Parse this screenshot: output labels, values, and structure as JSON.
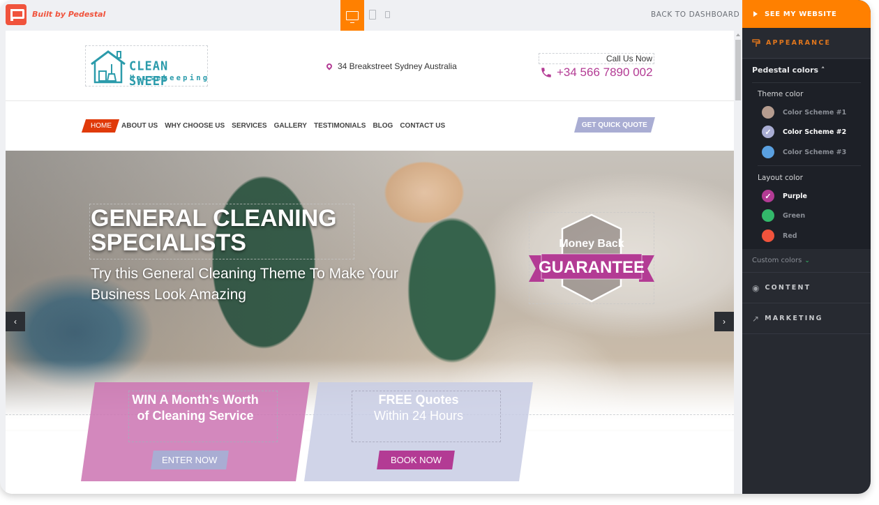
{
  "topbar": {
    "brand_text": "Built by Pedestal",
    "devices": [
      {
        "name": "desktop",
        "active": true
      },
      {
        "name": "tablet",
        "active": false
      },
      {
        "name": "mobile",
        "active": false
      }
    ],
    "back_label": "BACK TO DASHBOARD",
    "accent_color": "#ff8000"
  },
  "site": {
    "logo": {
      "line1": "CLEAN SWEEP",
      "line2": "Housekeeping"
    },
    "address": "34 Breakstreet Sydney Australia",
    "call_label": "Call Us Now",
    "phone": "+34 566 7890 002",
    "nav": {
      "items": [
        "HOME",
        "ABOUT US",
        "WHY CHOOSE US",
        "SERVICES",
        "GALLERY",
        "TESTIMONIALS",
        "BLOG",
        "CONTACT US"
      ],
      "active": "HOME",
      "quote_button": "GET QUICK QUOTE"
    },
    "hero": {
      "title_line1": "GENERAL CLEANING",
      "title_line2": "SPECIALISTS",
      "subtitle": "Try this General Cleaning Theme To Make Your Business Look Amazing",
      "badge_top": "Money Back",
      "badge_main": "GUARANTEE",
      "prev_arrow": "‹",
      "next_arrow": "›"
    },
    "promos": [
      {
        "title_line1": "WIN A Month's Worth",
        "title_line2": "of Cleaning Service",
        "button": "ENTER NOW"
      },
      {
        "title_line1": "FREE Quotes",
        "title_line2": "Within 24 Hours",
        "button": "BOOK NOW"
      }
    ],
    "colors": {
      "primary": "#b33b94",
      "secondary": "#a9add3",
      "nav_active": "#e03a0a",
      "brand_teal": "#2b9bab"
    }
  },
  "panel": {
    "see_website": "SEE MY WEBSITE",
    "sections": {
      "appearance": "APPEARANCE",
      "content": "CONTENT",
      "marketing": "MARKETING"
    },
    "pedestal_colors": "Pedestal colors",
    "theme_color_label": "Theme color",
    "theme_colors": [
      {
        "label": "Color Scheme #1",
        "color": "#b59c8f",
        "selected": false
      },
      {
        "label": "Color Scheme #2",
        "color": "#a9add3",
        "selected": true
      },
      {
        "label": "Color Scheme #3",
        "color": "#5aa0e0",
        "selected": false
      }
    ],
    "layout_color_label": "Layout color",
    "layout_colors": [
      {
        "label": "Purple",
        "color": "#b33b94",
        "selected": true
      },
      {
        "label": "Green",
        "color": "#33b86a",
        "selected": false
      },
      {
        "label": "Red",
        "color": "#f0533c",
        "selected": false
      }
    ],
    "custom_colors": "Custom colors"
  }
}
